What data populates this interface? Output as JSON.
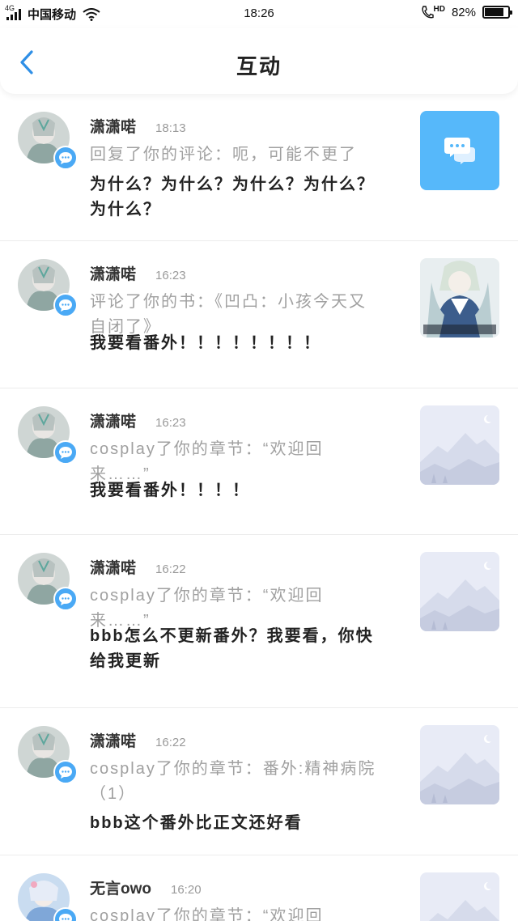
{
  "status_bar": {
    "network_type": "4G",
    "carrier": "中国移动",
    "time": "18:26",
    "hd_label": "HD",
    "battery_percent": "82%",
    "battery_level": 0.82
  },
  "nav": {
    "title": "互动"
  },
  "colors": {
    "accent": "#4aa9f5",
    "message_tile": "#56b8fa",
    "placeholder_bg": "#e8ebf6"
  },
  "items": [
    {
      "name": "潇潇喏",
      "time": "18:13",
      "action": "回复了你的评论：呃，可能不更了",
      "content": "为什么？为什么？为什么？为什么？为什么？",
      "thumb_type": "message-icon"
    },
    {
      "name": "潇潇喏",
      "time": "16:23",
      "action": "评论了你的书：《凹凸：小孩今天又自闭了》",
      "content": "我要看番外！！！！！！！！",
      "thumb_type": "book-cover"
    },
    {
      "name": "潇潇喏",
      "time": "16:23",
      "action": "cosplay了你的章节：“欢迎回来……”",
      "content": "我要看番外！！！！",
      "thumb_type": "placeholder-image"
    },
    {
      "name": "潇潇喏",
      "time": "16:22",
      "action": "cosplay了你的章节：“欢迎回来……”",
      "content": "bbb怎么不更新番外？我要看，你快给我更新",
      "thumb_type": "placeholder-image"
    },
    {
      "name": "潇潇喏",
      "time": "16:22",
      "action": "cosplay了你的章节：番外:精神病院（1）",
      "content": "bbb这个番外比正文还好看",
      "thumb_type": "placeholder-image"
    },
    {
      "name": "无言owo",
      "time": "16:20",
      "action": "cosplay了你的章节：“欢迎回",
      "content": "",
      "thumb_type": "placeholder-image"
    }
  ]
}
